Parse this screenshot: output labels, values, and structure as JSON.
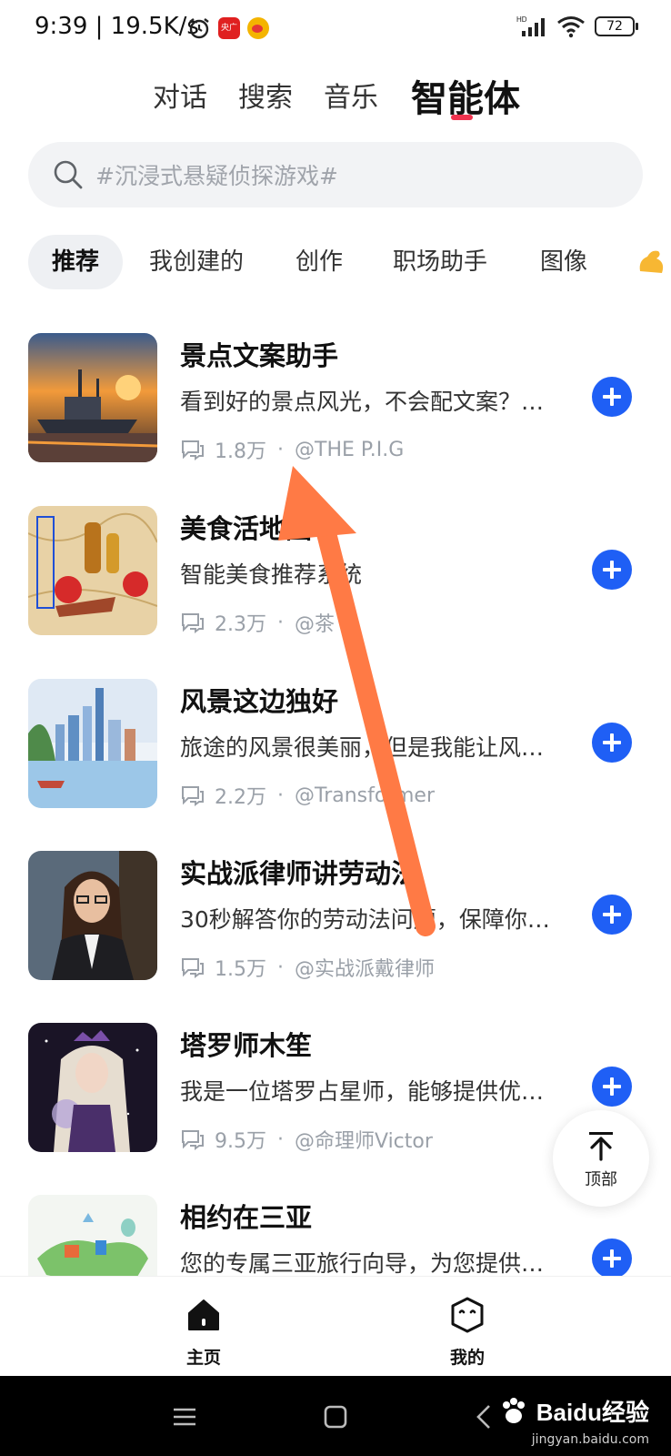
{
  "status_bar": {
    "time": "9:39 | 19.5K/s",
    "battery": "72",
    "network": "HD"
  },
  "top_tabs": [
    {
      "label": "对话"
    },
    {
      "label": "搜索"
    },
    {
      "label": "音乐"
    },
    {
      "label": "智能体",
      "active": true
    }
  ],
  "search": {
    "placeholder": "#沉浸式悬疑侦探游戏#"
  },
  "categories": [
    {
      "label": "推荐",
      "active": true
    },
    {
      "label": "我创建的"
    },
    {
      "label": "创作"
    },
    {
      "label": "职场助手"
    },
    {
      "label": "图像"
    }
  ],
  "agents": [
    {
      "title": "景点文案助手",
      "desc": "看到好的景点风光，不会配文案？…",
      "count": "1.8万",
      "author": "@THE P.I.G",
      "thumb": "harbor-ship"
    },
    {
      "title": "美食活地图",
      "desc": "智能美食推荐系统",
      "count": "2.3万",
      "author": "@茶",
      "thumb": "food-map"
    },
    {
      "title": "风景这边独好",
      "desc": "旅途的风景很美丽，但是我能让风…",
      "count": "2.2万",
      "author": "@Transformer",
      "thumb": "city-watercolor"
    },
    {
      "title": "实战派律师讲劳动法",
      "desc": "30秒解答你的劳动法问题，保障你…",
      "count": "1.5万",
      "author": "@实战派戴律师",
      "thumb": "lawyer-portrait"
    },
    {
      "title": "塔罗师木笙",
      "desc": "我是一位塔罗占星师，能够提供优…",
      "count": "9.5万",
      "author": "@命理师Victor",
      "thumb": "tarot-girl"
    },
    {
      "title": "相约在三亚",
      "desc": "您的专属三亚旅行向导，为您提供…",
      "count": "",
      "author": "",
      "thumb": "sanya-map"
    }
  ],
  "float_button": {
    "label": "顶部"
  },
  "bottom_nav": [
    {
      "label": "主页",
      "icon": "home-icon"
    },
    {
      "label": "我的",
      "icon": "profile-face-icon"
    }
  ],
  "watermark": {
    "brand": "Baidu经验",
    "url": "jingyan.baidu.com"
  },
  "colors": {
    "accent": "#1f5ff5",
    "tab_indicator": "#f0334f",
    "annotation_arrow": "#ff7a45"
  }
}
